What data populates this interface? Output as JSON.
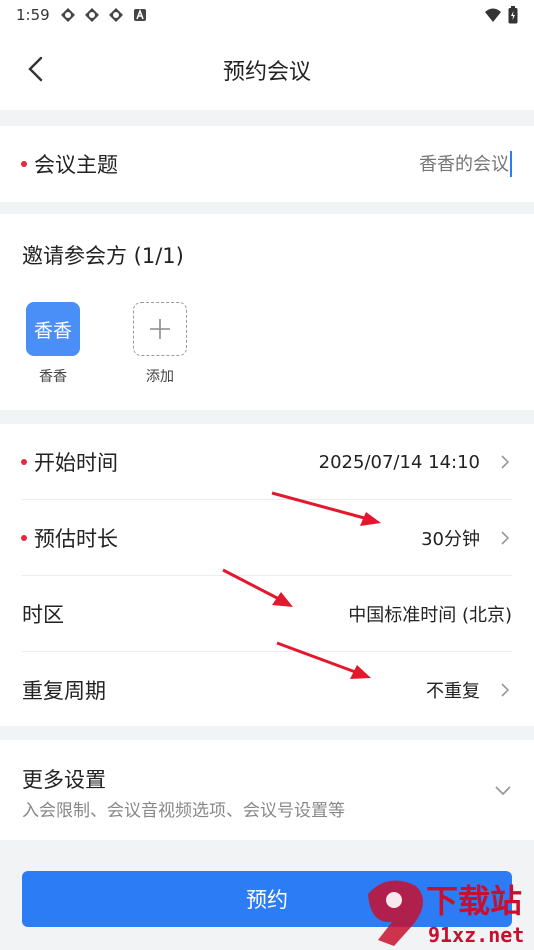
{
  "status_bar": {
    "time": "1:59"
  },
  "header": {
    "title": "预约会议"
  },
  "topic": {
    "label": "会议主题",
    "value": "香香的会议"
  },
  "invite": {
    "title": "邀请参会方 (1/1)",
    "participants": [
      {
        "avatar_text": "香香",
        "name": "香香"
      }
    ],
    "add_label": "添加"
  },
  "settings": {
    "start_time": {
      "label": "开始时间",
      "value": "2025/07/14 14:10"
    },
    "duration": {
      "label": "预估时长",
      "value": "30分钟"
    },
    "timezone": {
      "label": "时区",
      "value": "中国标准时间 (北京)"
    },
    "repeat": {
      "label": "重复周期",
      "value": "不重复"
    }
  },
  "more": {
    "title": "更多设置",
    "subtitle": "入会限制、会议音视频选项、会议号设置等"
  },
  "submit_label": "预约",
  "watermark": {
    "text_big": "下载站",
    "text_small": "91xz.net"
  },
  "colors": {
    "accent": "#2c7cf6",
    "required": "#e5283a",
    "avatar": "#4a8ef8",
    "annotation_arrow": "#e3182d"
  }
}
